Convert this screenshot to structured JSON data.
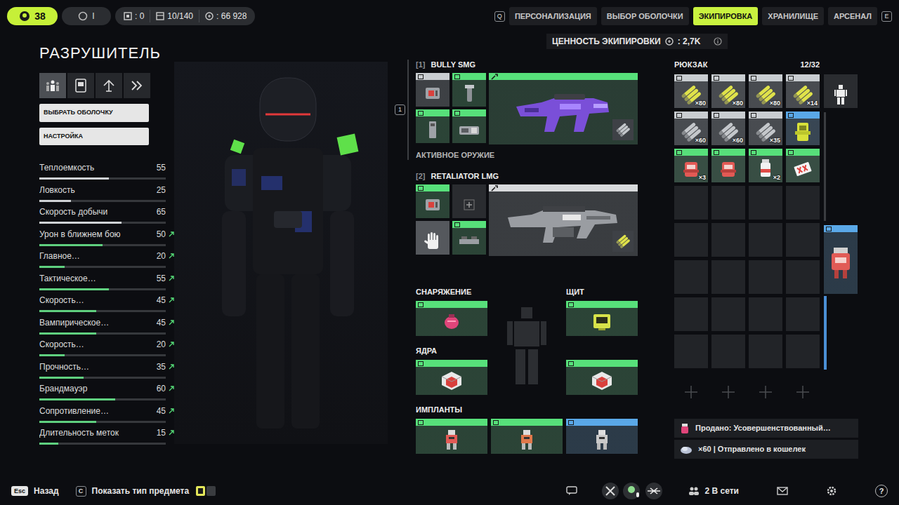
{
  "topbar": {
    "level": "38",
    "chips": [
      {
        "kind": "ring",
        "text": "I"
      },
      {
        "kind": "box",
        "text": ": 0"
      },
      {
        "kind": "crate",
        "text": "10/140"
      },
      {
        "kind": "coin",
        "text": ": 66 928"
      }
    ],
    "key_left": "Q",
    "tabs": [
      {
        "label": "ПЕРСОНАЛИЗАЦИЯ",
        "selected": false
      },
      {
        "label": "ВЫБОР ОБОЛОЧКИ",
        "selected": false
      },
      {
        "label": "ЭКИПИРОВКА",
        "selected": true
      },
      {
        "label": "ХРАНИЛИЩЕ",
        "selected": false
      },
      {
        "label": "АРСЕНАЛ",
        "selected": false
      }
    ],
    "key_right": "E"
  },
  "loadout_value": {
    "label": "ЦЕННОСТЬ ЭКИПИРОВКИ",
    "value": ": 2,7K"
  },
  "shell": {
    "title": "РАЗРУШИТЕЛЬ",
    "modes": [
      {
        "kind": "crowd",
        "selected": true
      },
      {
        "kind": "card",
        "selected": false
      },
      {
        "kind": "up",
        "selected": false
      },
      {
        "kind": "dash",
        "selected": false
      }
    ],
    "buttons": [
      "ВЫБРАТЬ ОБОЛОЧКУ",
      "НАСТРОЙКА"
    ],
    "stats": [
      {
        "label": "Теплоемкость",
        "value": "55",
        "level": 0.55,
        "boosted": false
      },
      {
        "label": "Ловкость",
        "value": "25",
        "level": 0.25,
        "boosted": false
      },
      {
        "label": "Скорость добычи",
        "value": "65",
        "level": 0.65,
        "boosted": false
      },
      {
        "label": "Урон в ближнем бою",
        "value": "50",
        "level": 0.5,
        "boosted": true
      },
      {
        "label": "Главное…",
        "value": "20",
        "level": 0.2,
        "boosted": true
      },
      {
        "label": "Тактическое…",
        "value": "55",
        "level": 0.55,
        "boosted": true
      },
      {
        "label": "Скорость…",
        "value": "45",
        "level": 0.45,
        "boosted": true
      },
      {
        "label": "Вампирическое…",
        "value": "45",
        "level": 0.45,
        "boosted": true
      },
      {
        "label": "Скорость…",
        "value": "20",
        "level": 0.2,
        "boosted": true
      },
      {
        "label": "Прочность…",
        "value": "35",
        "level": 0.35,
        "boosted": true
      },
      {
        "label": "Брандмауэр",
        "value": "60",
        "level": 0.6,
        "boosted": true
      },
      {
        "label": "Сопротивление…",
        "value": "45",
        "level": 0.45,
        "boosted": true
      },
      {
        "label": "Длительность меток",
        "value": "15",
        "level": 0.15,
        "boosted": true
      }
    ]
  },
  "weapons": [
    {
      "slot": "[1]",
      "name": "BULLY SMG",
      "color": "#57e07a",
      "active": true,
      "key": "1",
      "art": "smg",
      "ammo_kind": "ammo-med",
      "mods": [
        {
          "color": "#c9cdd1",
          "kind": "chip",
          "selected": false
        },
        {
          "color": "#57e07a",
          "kind": "grip",
          "selected": false
        },
        {
          "color": "#57e07a",
          "kind": "mag",
          "selected": false
        },
        {
          "color": "#57e07a",
          "kind": "barrel",
          "selected": false
        }
      ]
    },
    {
      "slot": "[2]",
      "name": "RETALIATOR LMG",
      "color": "#d8dadc",
      "active": false,
      "art": "lmg",
      "ammo_kind": "ammo-light",
      "mods": [
        {
          "color": "#57e07a",
          "kind": "chip",
          "selected": false
        },
        {
          "kind": "empty",
          "selected": false
        },
        {
          "kind": "hand",
          "selected": true
        },
        {
          "color": "#57e07a",
          "kind": "scope",
          "selected": false
        }
      ]
    }
  ],
  "active_label": "АКТИВНОЕ ОРУЖИЕ",
  "gear": {
    "equipment": {
      "label": "СНАРЯЖЕНИЕ",
      "color": "#57e07a",
      "kind": "grenade"
    },
    "shield": {
      "label": "ЩИТ",
      "color": "#57e07a",
      "kind": "shield"
    },
    "cores_label": "ЯДРА",
    "cores": [
      {
        "color": "#57e07a",
        "kind": "core"
      },
      {
        "color": "#57e07a",
        "kind": "core"
      }
    ],
    "implants_label": "ИМПЛАНТЫ",
    "implants": [
      {
        "color": "#57e07a",
        "kind": "implant-red"
      },
      {
        "color": "#57e07a",
        "kind": "implant-orange"
      },
      {
        "color": "#5aa8e8",
        "kind": "implant-grey"
      }
    ]
  },
  "backpack": {
    "title": "РЮКЗАК",
    "count": "12/32",
    "slots": [
      {
        "empty": false,
        "color": "#c9cdd1",
        "kind": "ammo-light",
        "count": "×80"
      },
      {
        "empty": false,
        "color": "#c9cdd1",
        "kind": "ammo-light",
        "count": "×80"
      },
      {
        "empty": false,
        "color": "#c9cdd1",
        "kind": "ammo-light",
        "count": "×80"
      },
      {
        "empty": false,
        "color": "#c9cdd1",
        "kind": "ammo-light",
        "count": "×14"
      },
      {
        "empty": false,
        "color": "#c9cdd1",
        "kind": "ammo-med",
        "count": "×60"
      },
      {
        "empty": false,
        "color": "#c9cdd1",
        "kind": "ammo-med",
        "count": "×60"
      },
      {
        "empty": false,
        "color": "#c9cdd1",
        "kind": "ammo-med",
        "count": "×35"
      },
      {
        "empty": false,
        "color": "#5aa8e8",
        "kind": "shield-cell"
      },
      {
        "empty": false,
        "color": "#57e07a",
        "kind": "medkit",
        "count": "×3"
      },
      {
        "empty": false,
        "color": "#57e07a",
        "kind": "medkit"
      },
      {
        "empty": false,
        "color": "#57e07a",
        "kind": "injector",
        "count": "×2"
      },
      {
        "empty": false,
        "color": "#57e07a",
        "kind": "card"
      },
      {
        "empty": true
      },
      {
        "empty": true
      },
      {
        "empty": true
      },
      {
        "empty": true
      },
      {
        "empty": true
      },
      {
        "empty": true
      },
      {
        "empty": true
      },
      {
        "empty": true
      },
      {
        "empty": true
      },
      {
        "empty": true
      },
      {
        "empty": true
      },
      {
        "empty": true
      },
      {
        "empty": true
      },
      {
        "empty": true
      },
      {
        "empty": true
      },
      {
        "empty": true
      },
      {
        "empty": true
      },
      {
        "empty": true
      },
      {
        "empty": true
      },
      {
        "empty": true
      }
    ],
    "side": [
      {
        "kind": "figure"
      },
      {
        "kind": "pack",
        "color": "#5aa8e8"
      }
    ]
  },
  "notifications": [
    {
      "kind": "sold",
      "text": "Продано: Усовершенствованный…"
    },
    {
      "kind": "wallet",
      "text": "×60 | Отправлено в кошелек"
    }
  ],
  "bottom": {
    "actions": [
      {
        "key": "Esc",
        "label": "Назад"
      },
      {
        "key": "C",
        "label": "Показать тип предмета"
      }
    ],
    "show_type_on": true,
    "online": "2 В сети",
    "help": "?"
  }
}
